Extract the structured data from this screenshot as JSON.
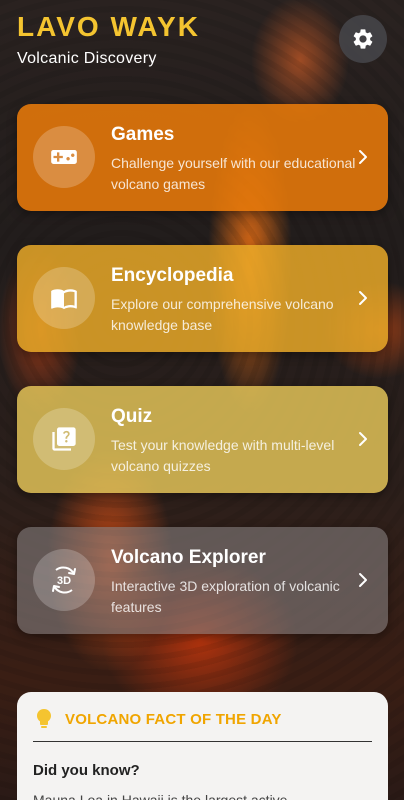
{
  "header": {
    "title": "LAVO WAYK",
    "subtitle": "Volcanic Discovery"
  },
  "icons": {
    "settings": "gear-icon",
    "games": "gamepad-icon",
    "encyclopedia": "book-icon",
    "quiz": "quiz-icon",
    "explorer": "3d-rotation-icon",
    "chevron": "chevron-right-icon",
    "fact": "lightbulb-icon"
  },
  "colors": {
    "accent": "#f4c430",
    "games": "#e87a0a",
    "encyclopedia": "#e8a828",
    "quiz": "#e8c85a",
    "explorer": "#827d7d",
    "fact_title": "#f0a500"
  },
  "cards": [
    {
      "title": "Games",
      "description": "Challenge yourself with our educational volcano games"
    },
    {
      "title": "Encyclopedia",
      "description": "Explore our comprehensive volcano knowledge base"
    },
    {
      "title": "Quiz",
      "description": "Test your knowledge with multi-level volcano quizzes"
    },
    {
      "title": "Volcano Explorer",
      "description": "Interactive 3D exploration of volcanic features"
    }
  ],
  "fact": {
    "title": "VOLCANO FACT OF THE DAY",
    "question": "Did you know?",
    "body": "Mauna Loa in Hawaii is the largest active"
  }
}
